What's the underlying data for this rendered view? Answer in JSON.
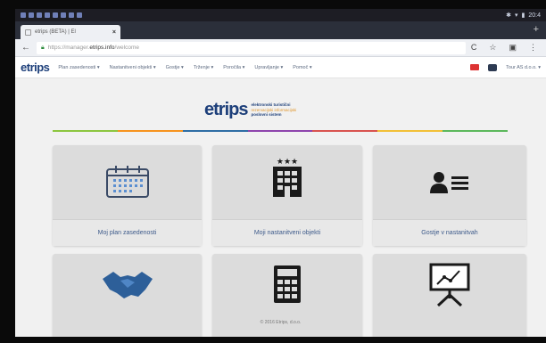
{
  "status_bar": {
    "time": "20:4"
  },
  "browser": {
    "tab_title": "etrips (BETA) | El",
    "tab_close": "×",
    "new_tab": "+",
    "back": "←",
    "url_scheme": "https://manager.",
    "url_host": "etrips.info",
    "url_path": "/welcome",
    "reload": "C",
    "star": "☆",
    "tabs_icon": "▣",
    "menu": "⋮"
  },
  "nav": {
    "logo_prefix": "et",
    "logo_mid": "r",
    "logo_suffix": "ips",
    "items": [
      {
        "label": "Plan zasedenosti"
      },
      {
        "label": "Nastanitveni objekti"
      },
      {
        "label": "Gostje"
      },
      {
        "label": "Trženje"
      },
      {
        "label": "Poročila"
      },
      {
        "label": "Upravljanje"
      },
      {
        "label": "Pomoč"
      }
    ],
    "user": "Tour AS d.o.o."
  },
  "brand": {
    "logo": "etrips",
    "line1": "elektronski turistični",
    "line2": "rezervacijski informacijski",
    "line3": "poslovni sistem"
  },
  "rainbow_colors": [
    "#8cc63f",
    "#f7931e",
    "#2e6da4",
    "#8e44ad",
    "#d9534f",
    "#f2c037",
    "#5cb85c"
  ],
  "tiles": [
    {
      "label": "Moj plan zasedenosti",
      "icon": "calendar-icon"
    },
    {
      "label": "Moji nastanitveni objekti",
      "icon": "hotel-icon"
    },
    {
      "label": "Gostje v nastanitvah",
      "icon": "guest-card-icon"
    },
    {
      "label": "",
      "icon": "handshake-icon"
    },
    {
      "label": "",
      "icon": "calculator-icon"
    },
    {
      "label": "",
      "icon": "presentation-chart-icon"
    }
  ],
  "footer": "© 2016 Etrips, d.o.o."
}
